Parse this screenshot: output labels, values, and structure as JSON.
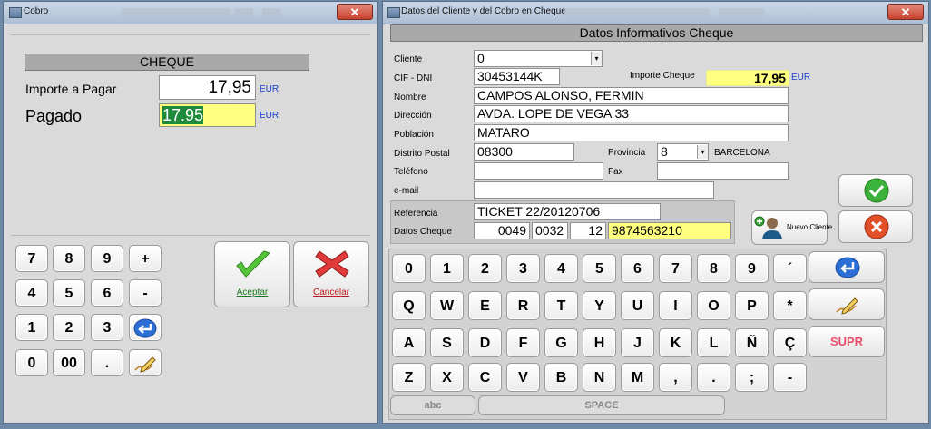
{
  "left_window": {
    "title": "Cobro",
    "header": "CHEQUE",
    "importe_label": "Importe a Pagar",
    "importe_value": "17,95",
    "pagado_label": "Pagado",
    "pagado_value": "17.95",
    "currency": "EUR",
    "keypad": [
      "7",
      "8",
      "9",
      "+",
      "4",
      "5",
      "6",
      "-",
      "1",
      "2",
      "3",
      "",
      "0",
      "00",
      "."
    ],
    "accept_label": "Aceptar",
    "cancel_label": "Cancelar"
  },
  "right_window": {
    "title": "Datos del Cliente y del Cobro en Cheque",
    "header": "Datos Informativos Cheque",
    "labels": {
      "cliente": "Cliente",
      "cif": "CIF - DNI",
      "nombre": "Nombre",
      "direccion": "Dirección",
      "poblacion": "Población",
      "distrito": "Distrito Postal",
      "provincia": "Provincia",
      "telefono": "Teléfono",
      "fax": "Fax",
      "email": "e-mail",
      "referencia": "Referencia",
      "datos_cheque": "Datos Cheque",
      "importe_cheque": "Importe Cheque"
    },
    "values": {
      "cliente": "0",
      "cif": "30453144K",
      "importe": "17,95",
      "currency": "EUR",
      "nombre": "CAMPOS ALONSO, FERMIN",
      "direccion": "AVDA. LOPE DE VEGA 33",
      "poblacion": "MATARO",
      "distrito": "08300",
      "provincia_code": "8",
      "provincia_name": "BARCELONA",
      "telefono": "",
      "fax": "",
      "email": "",
      "referencia": "TICKET  22/20120706",
      "cheque_1": "0049",
      "cheque_2": "0032",
      "cheque_3": "12",
      "cheque_4": "9874563210"
    },
    "nuevo_cliente": "Nuevo Cliente",
    "keyboard": {
      "row1": [
        "0",
        "1",
        "2",
        "3",
        "4",
        "5",
        "6",
        "7",
        "8",
        "9",
        "´"
      ],
      "row2": [
        "Q",
        "W",
        "E",
        "R",
        "T",
        "Y",
        "U",
        "I",
        "O",
        "P",
        "*"
      ],
      "row3": [
        "A",
        "S",
        "D",
        "F",
        "G",
        "H",
        "J",
        "K",
        "L",
        "Ñ",
        "Ç"
      ],
      "row4": [
        "Z",
        "X",
        "C",
        "V",
        "B",
        "N",
        "M",
        ",",
        ".",
        ";",
        "-"
      ],
      "supr": "SUPR",
      "abc": "abc",
      "space": "SPACE"
    }
  }
}
